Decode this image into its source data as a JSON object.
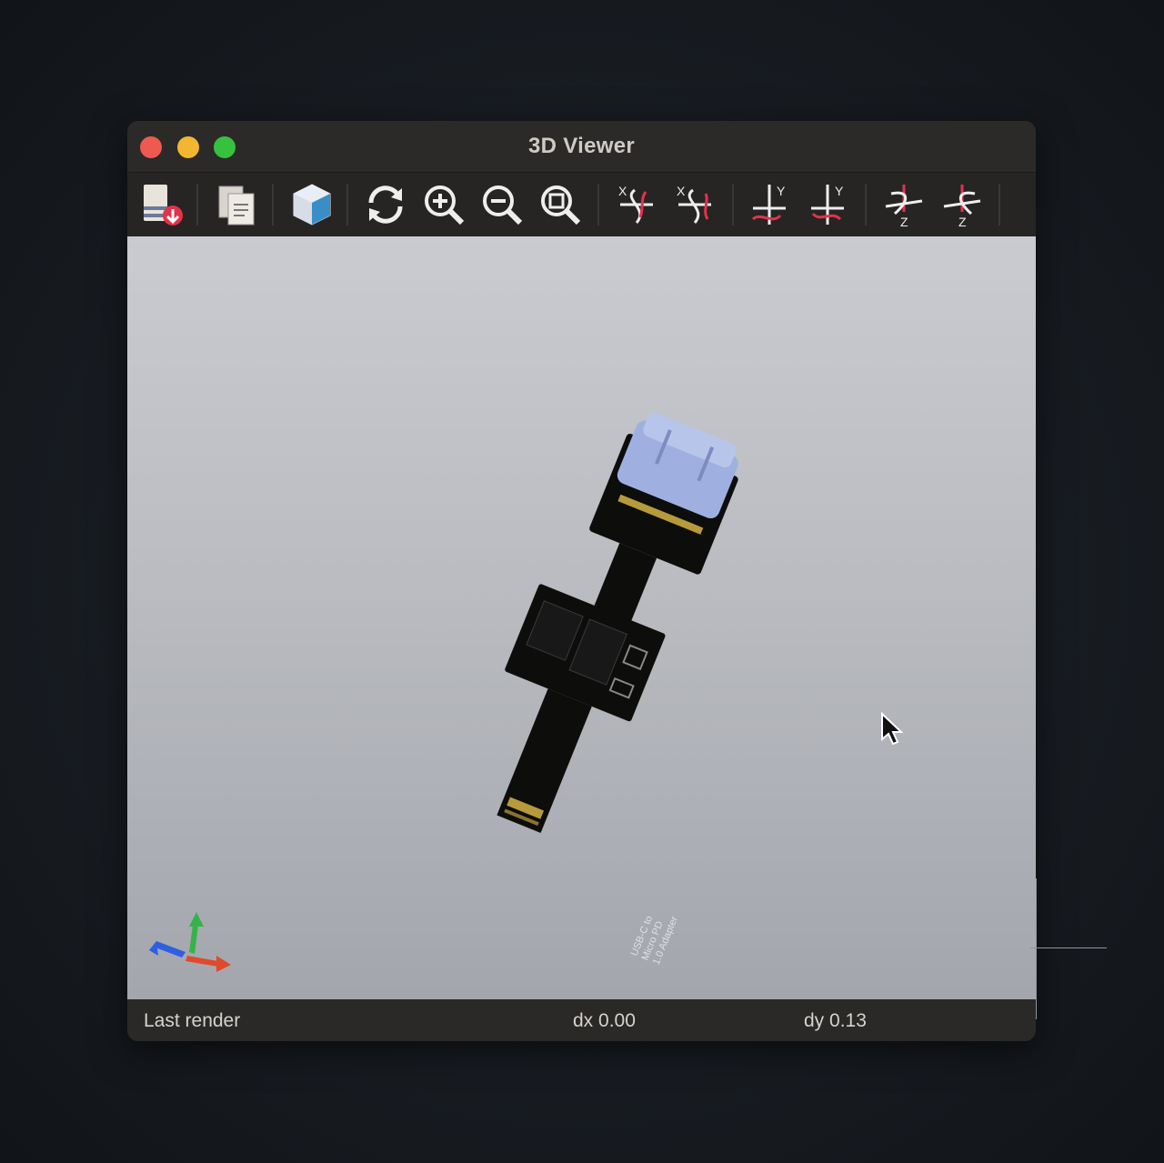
{
  "window": {
    "title": "3D Viewer"
  },
  "toolbar": {
    "buttons": [
      {
        "name": "export-image-icon"
      },
      {
        "name": "copy-icon"
      },
      {
        "name": "raytrace-icon"
      },
      {
        "name": "reload-icon"
      },
      {
        "name": "zoom-in-icon"
      },
      {
        "name": "zoom-out-icon"
      },
      {
        "name": "zoom-fit-icon"
      },
      {
        "name": "rotate-x-cw-icon"
      },
      {
        "name": "rotate-x-ccw-icon"
      },
      {
        "name": "rotate-y-cw-icon"
      },
      {
        "name": "rotate-y-ccw-icon"
      },
      {
        "name": "rotate-z-cw-icon"
      },
      {
        "name": "rotate-z-ccw-icon"
      }
    ]
  },
  "statusbar": {
    "left": "Last render",
    "dx": "dx 0.00",
    "dy": "dy 0.13"
  },
  "colors": {
    "pcb": "#0d0d0c",
    "connector": "#9fb0e0",
    "axis_x": "#e04a2a",
    "axis_y": "#34b34a",
    "axis_z": "#2f5fe0"
  }
}
